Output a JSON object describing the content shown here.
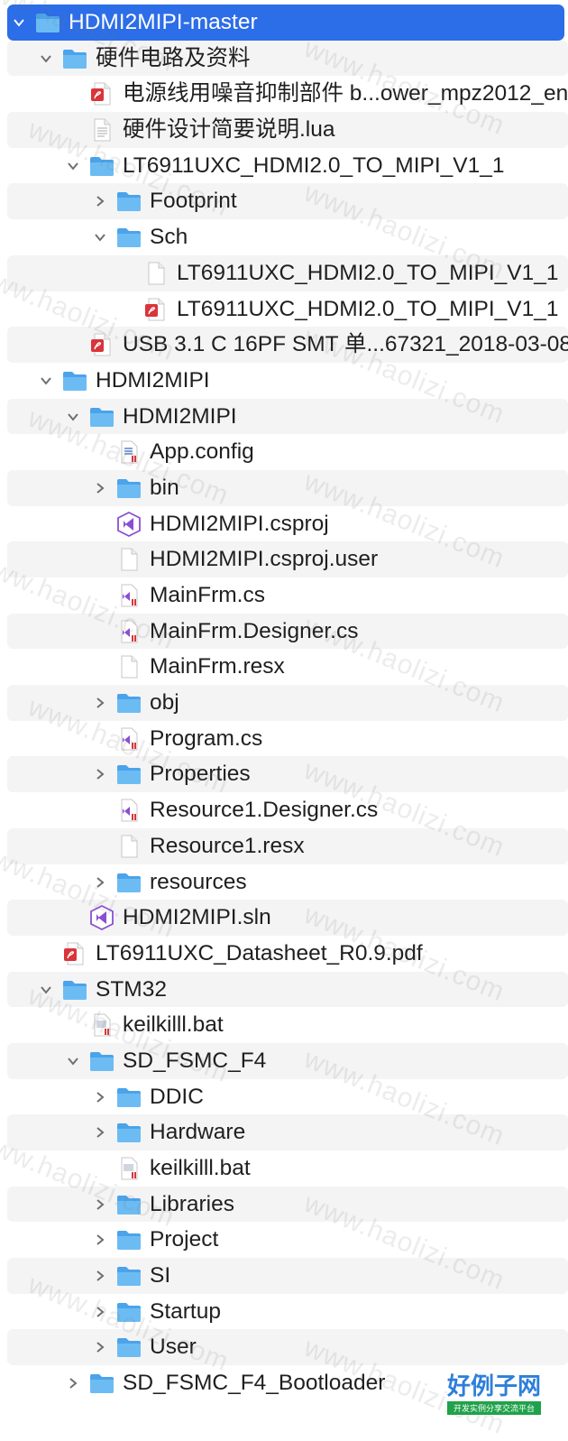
{
  "rows": [
    {
      "label": "HDMI2MIPI-master",
      "depth": 0,
      "icon": "folder-icon",
      "disclosure": "down",
      "selected": true
    },
    {
      "label": "硬件电路及资料",
      "depth": 1,
      "icon": "folder-icon",
      "disclosure": "down"
    },
    {
      "label": "电源线用噪音抑制部件 b...ower_mpz2012_en",
      "depth": 2,
      "icon": "pdf-file-icon",
      "disclosure": "none"
    },
    {
      "label": "硬件设计简要说明.lua",
      "depth": 2,
      "icon": "text-file-icon",
      "disclosure": "none"
    },
    {
      "label": "LT6911UXC_HDMI2.0_TO_MIPI_V1_1",
      "depth": 2,
      "icon": "folder-icon",
      "disclosure": "down"
    },
    {
      "label": "Footprint",
      "depth": 3,
      "icon": "folder-icon",
      "disclosure": "right"
    },
    {
      "label": "Sch",
      "depth": 3,
      "icon": "folder-icon",
      "disclosure": "down"
    },
    {
      "label": "LT6911UXC_HDMI2.0_TO_MIPI_V1_1",
      "depth": 4,
      "icon": "blank-file-icon",
      "disclosure": "none"
    },
    {
      "label": "LT6911UXC_HDMI2.0_TO_MIPI_V1_1",
      "depth": 4,
      "icon": "pdf-file-icon",
      "disclosure": "none"
    },
    {
      "label": "USB 3.1 C 16PF SMT 单...67321_2018-03-08",
      "depth": 2,
      "icon": "pdf-file-icon",
      "disclosure": "none"
    },
    {
      "label": "HDMI2MIPI",
      "depth": 1,
      "icon": "folder-icon",
      "disclosure": "down"
    },
    {
      "label": "HDMI2MIPI",
      "depth": 2,
      "icon": "folder-icon",
      "disclosure": "down"
    },
    {
      "label": "App.config",
      "depth": 3,
      "icon": "config-file-icon",
      "disclosure": "none"
    },
    {
      "label": "bin",
      "depth": 3,
      "icon": "folder-icon",
      "disclosure": "right"
    },
    {
      "label": "HDMI2MIPI.csproj",
      "depth": 3,
      "icon": "visual-studio-icon",
      "disclosure": "none"
    },
    {
      "label": "HDMI2MIPI.csproj.user",
      "depth": 3,
      "icon": "blank-file-icon",
      "disclosure": "none"
    },
    {
      "label": "MainFrm.cs",
      "depth": 3,
      "icon": "csharp-file-icon",
      "disclosure": "none"
    },
    {
      "label": "MainFrm.Designer.cs",
      "depth": 3,
      "icon": "csharp-file-icon",
      "disclosure": "none"
    },
    {
      "label": "MainFrm.resx",
      "depth": 3,
      "icon": "blank-file-icon",
      "disclosure": "none"
    },
    {
      "label": "obj",
      "depth": 3,
      "icon": "folder-icon",
      "disclosure": "right"
    },
    {
      "label": "Program.cs",
      "depth": 3,
      "icon": "csharp-file-icon",
      "disclosure": "none"
    },
    {
      "label": "Properties",
      "depth": 3,
      "icon": "folder-icon",
      "disclosure": "right"
    },
    {
      "label": "Resource1.Designer.cs",
      "depth": 3,
      "icon": "csharp-file-icon",
      "disclosure": "none"
    },
    {
      "label": "Resource1.resx",
      "depth": 3,
      "icon": "blank-file-icon",
      "disclosure": "none"
    },
    {
      "label": "resources",
      "depth": 3,
      "icon": "folder-icon",
      "disclosure": "right"
    },
    {
      "label": "HDMI2MIPI.sln",
      "depth": 2,
      "icon": "visual-studio-icon",
      "disclosure": "none"
    },
    {
      "label": "LT6911UXC_Datasheet_R0.9.pdf",
      "depth": 1,
      "icon": "pdf-file-icon",
      "disclosure": "none"
    },
    {
      "label": "STM32",
      "depth": 1,
      "icon": "folder-icon",
      "disclosure": "down"
    },
    {
      "label": "keilkilll.bat",
      "depth": 2,
      "icon": "script-file-icon",
      "disclosure": "none"
    },
    {
      "label": "SD_FSMC_F4",
      "depth": 2,
      "icon": "folder-icon",
      "disclosure": "down"
    },
    {
      "label": "DDIC",
      "depth": 3,
      "icon": "folder-icon",
      "disclosure": "right"
    },
    {
      "label": "Hardware",
      "depth": 3,
      "icon": "folder-icon",
      "disclosure": "right"
    },
    {
      "label": "keilkilll.bat",
      "depth": 3,
      "icon": "script-file-icon",
      "disclosure": "none"
    },
    {
      "label": "Libraries",
      "depth": 3,
      "icon": "folder-icon",
      "disclosure": "right"
    },
    {
      "label": "Project",
      "depth": 3,
      "icon": "folder-icon",
      "disclosure": "right"
    },
    {
      "label": "SI",
      "depth": 3,
      "icon": "folder-icon",
      "disclosure": "right"
    },
    {
      "label": "Startup",
      "depth": 3,
      "icon": "folder-icon",
      "disclosure": "right"
    },
    {
      "label": "User",
      "depth": 3,
      "icon": "folder-icon",
      "disclosure": "right"
    },
    {
      "label": "SD_FSMC_F4_Bootloader",
      "depth": 2,
      "icon": "folder-icon",
      "disclosure": "right"
    }
  ],
  "watermark": "www.haolizi.com",
  "brand": {
    "title": "好例子网",
    "subtitle": "开发实例分享交流平台"
  },
  "colors": {
    "selection": "#2c6de8",
    "folder": "#5aaef0",
    "pdf": "#d9353a",
    "vs": "#8a4fd1"
  }
}
